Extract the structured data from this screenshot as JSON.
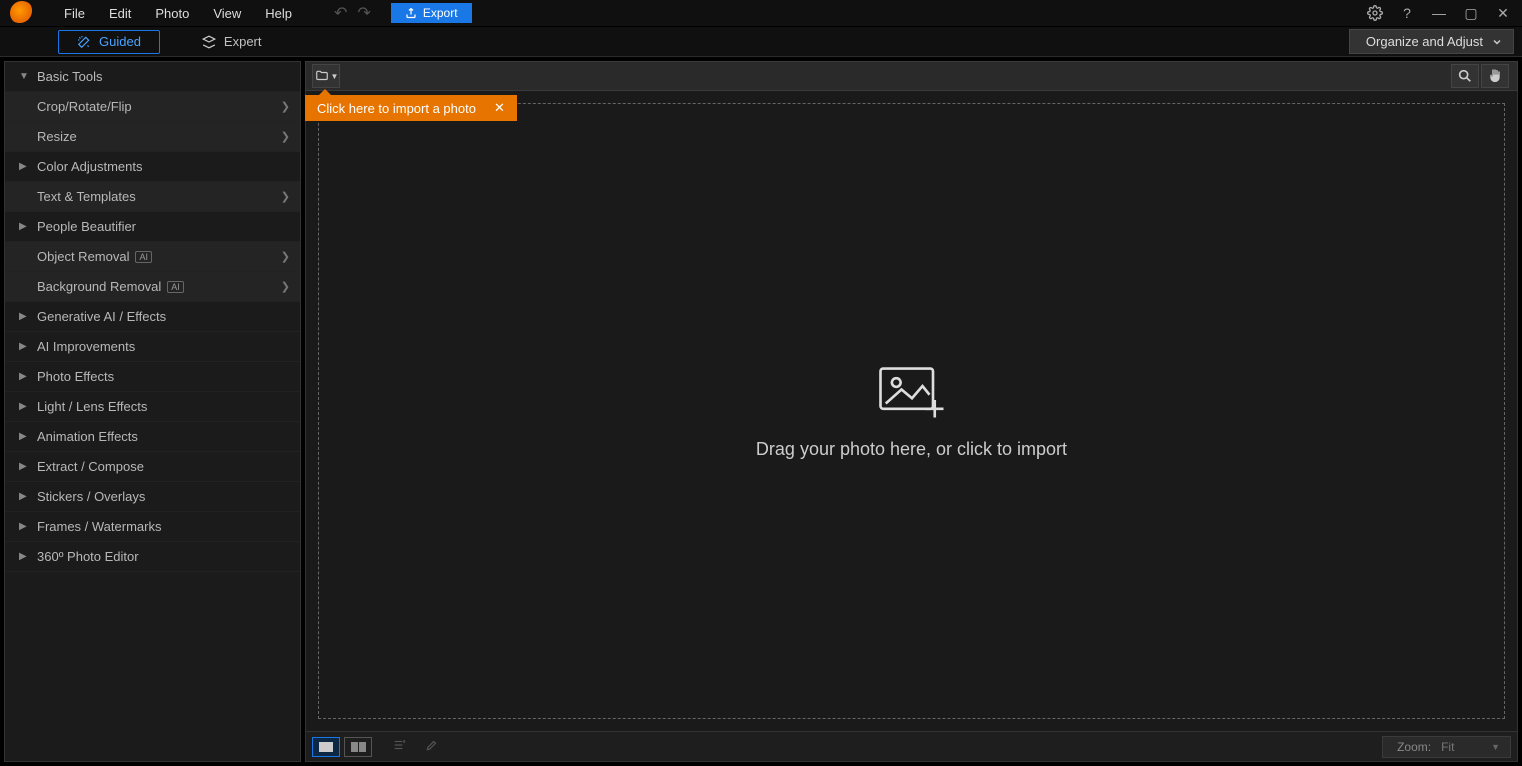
{
  "menu": {
    "file": "File",
    "edit": "Edit",
    "photo": "Photo",
    "view": "View",
    "help": "Help"
  },
  "toolbar": {
    "export": "Export"
  },
  "modes": {
    "guided": "Guided",
    "expert": "Expert",
    "organize": "Organize and Adjust"
  },
  "sidebar": {
    "basic": "Basic Tools",
    "crop": "Crop/Rotate/Flip",
    "resize": "Resize",
    "color": "Color Adjustments",
    "text": "Text & Templates",
    "people": "People Beautifier",
    "object": "Object Removal",
    "bg": "Background Removal",
    "gen": "Generative AI / Effects",
    "aiimp": "AI Improvements",
    "photoeff": "Photo Effects",
    "light": "Light / Lens Effects",
    "anim": "Animation Effects",
    "extract": "Extract / Compose",
    "stickers": "Stickers / Overlays",
    "frames": "Frames / Watermarks",
    "pano": "360º Photo Editor",
    "ai_badge": "AI"
  },
  "tooltip": {
    "text": "Click here to import a photo",
    "close": "✕"
  },
  "canvas": {
    "drop": "Drag your photo here, or click to import"
  },
  "footer": {
    "zoom_label": "Zoom:",
    "zoom_value": "Fit"
  }
}
